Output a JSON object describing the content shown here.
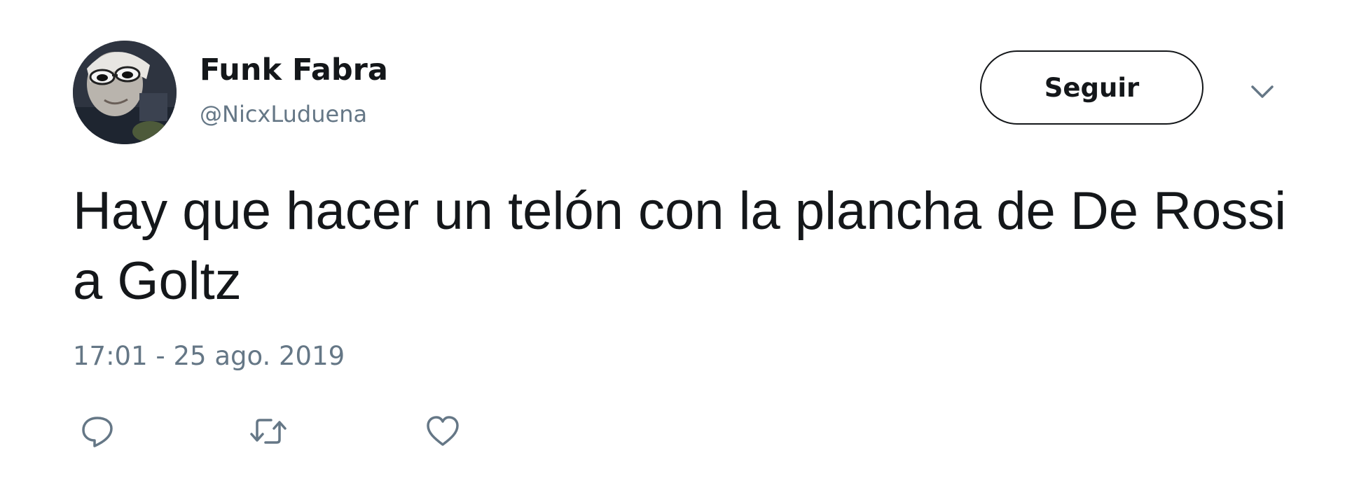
{
  "tweet": {
    "author": {
      "display_name": "Funk Fabra",
      "handle": "@NicxLuduena",
      "avatar_icon": "user-avatar"
    },
    "follow_button_label": "Seguir",
    "menu_icon": "chevron-down-icon",
    "text": "Hay que hacer un telón con la plancha de De Rossi a Goltz",
    "timestamp": "17:01 - 25 ago. 2019",
    "actions": [
      {
        "name": "reply",
        "icon": "reply-icon"
      },
      {
        "name": "retweet",
        "icon": "retweet-icon"
      },
      {
        "name": "like",
        "icon": "heart-icon"
      }
    ]
  },
  "colors": {
    "text_primary": "#14171a",
    "text_secondary": "#657786",
    "button_border": "#14171a",
    "background": "#ffffff"
  }
}
